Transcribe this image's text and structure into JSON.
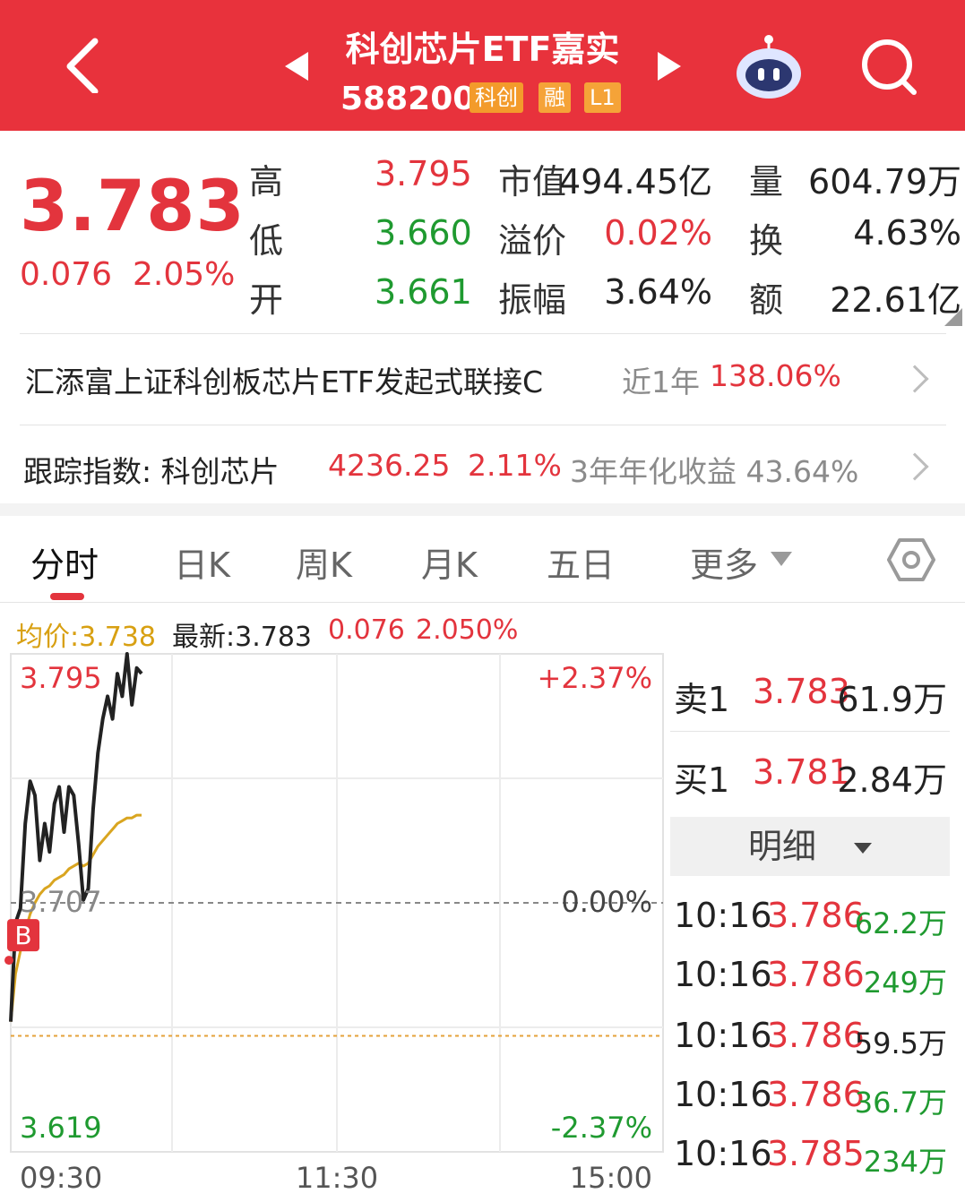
{
  "header": {
    "title": "科创芯片ETF嘉实",
    "code": "588200",
    "tags": [
      "科创",
      "融",
      "L1"
    ]
  },
  "quote": {
    "price": "3.783",
    "change": "0.076",
    "change_pct": "2.05%",
    "stats": [
      {
        "label": "高",
        "value": "3.795"
      },
      {
        "label": "低",
        "value": "3.660"
      },
      {
        "label": "开",
        "value": "3.661"
      },
      {
        "label": "市值",
        "value": "494.45亿"
      },
      {
        "label": "溢价",
        "value": "0.02%"
      },
      {
        "label": "振幅",
        "value": "3.64%"
      },
      {
        "label": "量",
        "value": "604.79万"
      },
      {
        "label": "换",
        "value": "4.63%"
      },
      {
        "label": "额",
        "value": "22.61亿"
      }
    ]
  },
  "linked_fund": {
    "name": "汇添富上证科创板芯片ETF发起式联接C",
    "period_label": "近1年",
    "return": "138.06%"
  },
  "tracking_index": {
    "label": "跟踪指数: 科创芯片",
    "value": "4236.25",
    "change_pct": "2.11%",
    "annualized": "3年年化收益 43.64%"
  },
  "tabs": [
    "分时",
    "日K",
    "周K",
    "月K",
    "五日",
    "更多"
  ],
  "chart_info": {
    "avg": "均价:3.738",
    "latest": "最新:3.783",
    "change": "0.076",
    "change_pct": "2.050%"
  },
  "chart_data": {
    "type": "line",
    "title": "",
    "x_ticks": [
      "09:30",
      "11:30",
      "15:00"
    ],
    "y_left": {
      "top": "3.795",
      "mid": "3.707",
      "bottom": "3.619"
    },
    "y_right": {
      "top": "+2.37%",
      "mid": "0.00%",
      "bottom": "-2.37%"
    },
    "ylim": [
      3.619,
      3.795
    ],
    "prev_close": 3.707,
    "marker": "B",
    "series": [
      {
        "values": [
          3.665,
          3.7,
          3.705,
          3.735,
          3.75,
          3.745,
          3.722,
          3.735,
          3.725,
          3.742,
          3.748,
          3.732,
          3.748,
          3.745,
          3.728,
          3.708,
          3.712,
          3.74,
          3.76,
          3.772,
          3.78,
          3.772,
          3.788,
          3.78,
          3.795,
          3.777,
          3.79,
          3.788
        ]
      },
      {
        "values": [
          3.665,
          3.682,
          3.69,
          3.697,
          3.703,
          3.707,
          3.71,
          3.712,
          3.713,
          3.715,
          3.716,
          3.717,
          3.719,
          3.72,
          3.721,
          3.72,
          3.721,
          3.724,
          3.727,
          3.729,
          3.731,
          3.733,
          3.735,
          3.736,
          3.737,
          3.737,
          3.738,
          3.738
        ]
      }
    ],
    "colors": {
      "price": "#222222",
      "avg": "#d9a520"
    }
  },
  "order_book": {
    "sell1": {
      "label": "卖1",
      "price": "3.783",
      "volume": "61.9万"
    },
    "buy1": {
      "label": "买1",
      "price": "3.781",
      "volume": "2.84万"
    }
  },
  "detail_label": "明细",
  "trades": [
    {
      "time": "10:16",
      "price": "3.786",
      "volume": "62.2万",
      "side": "buy"
    },
    {
      "time": "10:16",
      "price": "3.786",
      "volume": "249万",
      "side": "buy"
    },
    {
      "time": "10:16",
      "price": "3.786",
      "volume": "59.5万",
      "side": "neutral"
    },
    {
      "time": "10:16",
      "price": "3.786",
      "volume": "36.7万",
      "side": "buy"
    },
    {
      "time": "10:16",
      "price": "3.785",
      "volume": "234万",
      "side": "buy"
    }
  ]
}
